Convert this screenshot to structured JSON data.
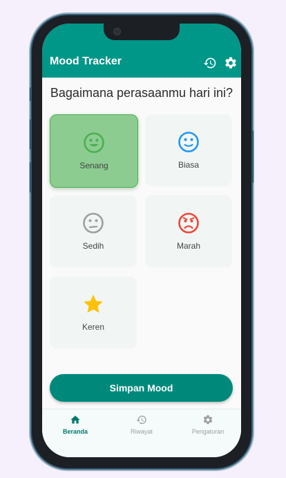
{
  "appbar": {
    "title": "Mood Tracker"
  },
  "question": "Bagaimana perasaanmu hari ini?",
  "moods": [
    {
      "label": "Senang",
      "icon": "happy-face-icon",
      "color": "#4caf50",
      "selected": true
    },
    {
      "label": "Biasa",
      "icon": "neutral-face-icon",
      "color": "#2196f3",
      "selected": false
    },
    {
      "label": "Sedih",
      "icon": "sad-face-icon",
      "color": "#9e9e9e",
      "selected": false
    },
    {
      "label": "Marah",
      "icon": "angry-face-icon",
      "color": "#f44336",
      "selected": false
    },
    {
      "label": "Keren",
      "icon": "star-icon",
      "color": "#ffc107",
      "selected": false
    }
  ],
  "save_button": "Simpan Mood",
  "bottom_nav": [
    {
      "label": "Beranda",
      "icon": "home-icon",
      "active": true
    },
    {
      "label": "Riwayat",
      "icon": "history-icon",
      "active": false
    },
    {
      "label": "Pengaturan",
      "icon": "settings-icon",
      "active": false
    }
  ],
  "colors": {
    "primary": "#009688",
    "button": "#00897b",
    "selected_card": "#8ccc91"
  }
}
